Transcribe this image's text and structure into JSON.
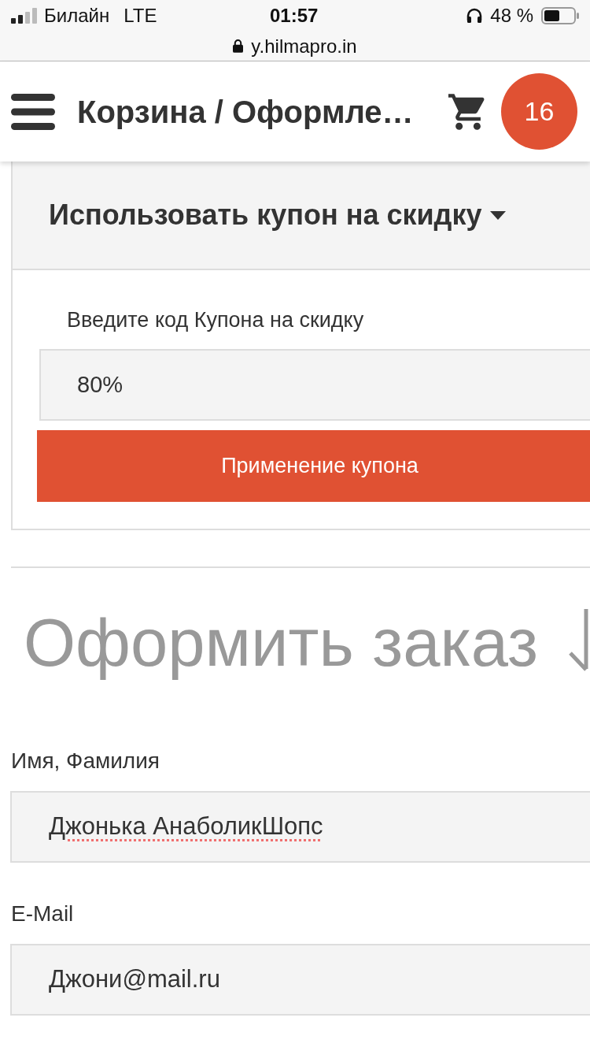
{
  "status_bar": {
    "carrier": "Билайн",
    "network": "LTE",
    "time": "01:57",
    "battery": "48 %"
  },
  "address_bar": {
    "url": "y.hilmapro.in"
  },
  "header": {
    "title": "Корзина / Оформле…",
    "cart_count": "16"
  },
  "coupon": {
    "title": "Использовать купон на скидку",
    "expanded": true,
    "label": "Введите код Купона на скидку",
    "value": "80%",
    "button": "Применение купона"
  },
  "checkout": {
    "heading": "Оформить заказ",
    "fields": [
      {
        "label": "Имя, Фамилия",
        "value": "Джонька АнаболикШопс",
        "misspelled": true
      },
      {
        "label": "E-Mail",
        "value": "Джони@mail.ru",
        "misspelled": false
      }
    ]
  }
}
